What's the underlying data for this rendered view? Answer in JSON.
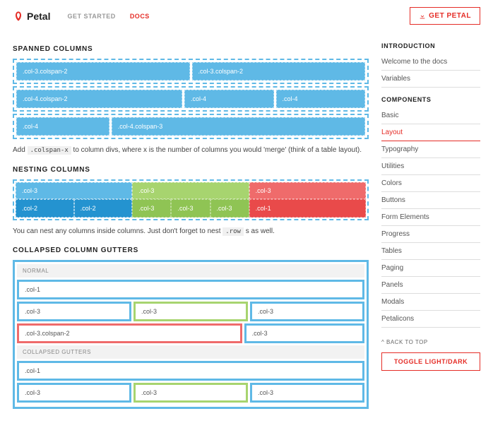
{
  "brand": "Petal",
  "nav": {
    "get_started": "GET STARTED",
    "docs": "DOCS"
  },
  "cta": "GET PETAL",
  "sidebar": {
    "intro_head": "INTRODUCTION",
    "intro": [
      "Welcome to the docs",
      "Variables"
    ],
    "comp_head": "COMPONENTS",
    "components": [
      "Basic",
      "Layout",
      "Typography",
      "Utilities",
      "Colors",
      "Buttons",
      "Form Elements",
      "Progress",
      "Tables",
      "Paging",
      "Panels",
      "Modals",
      "Petalicons"
    ],
    "active_index": 1,
    "back": "BACK TO TOP",
    "toggle": "TOGGLE LIGHT/DARK"
  },
  "sections": {
    "spanned": {
      "title": "SPANNED COLUMNS",
      "rows": [
        [
          {
            "label": ".col-3.colspan-2",
            "flex": 2
          },
          {
            "label": ".col-3.colspan-2",
            "flex": 2
          }
        ],
        [
          {
            "label": ".col-4.colspan-2",
            "flex": 2
          },
          {
            "label": ".col-4",
            "flex": 1
          },
          {
            "label": ".col-4",
            "flex": 1
          }
        ],
        [
          {
            "label": ".col-4",
            "flex": 1
          },
          {
            "label": ".col-4.colspan-3",
            "flex": 3
          }
        ]
      ],
      "desc_pre": "Add ",
      "desc_code": ".colspan-x",
      "desc_post": " to column divs, where x is the number of columns you would 'merge' (think of a table layout)."
    },
    "nesting": {
      "title": "NESTING COLUMNS",
      "cols": [
        {
          "head": ".col-3",
          "cells": [
            ".col-2",
            ".col-2"
          ],
          "outer": "blue-l",
          "inner": "blue-d"
        },
        {
          "head": ".col-3",
          "cells": [
            ".col-3",
            ".col-3",
            ".col-3"
          ],
          "outer": "green-l",
          "inner": "green-d"
        },
        {
          "head": ".col-3",
          "cells": [
            ".col-1"
          ],
          "outer": "red-l",
          "inner": "red-d"
        }
      ],
      "desc_pre": "You can nest any columns inside columns. Just don't forget to nest ",
      "desc_code": ".row",
      "desc_post": " s as well."
    },
    "collapsed": {
      "title": "COLLAPSED COLUMN GUTTERS",
      "normal_label": "NORMAL",
      "collapsed_label": "COLLAPSED GUTTERS",
      "rows_normal": [
        [
          {
            "label": ".col-1",
            "cls": ""
          }
        ],
        [
          {
            "label": ".col-3",
            "cls": ""
          },
          {
            "label": ".col-3",
            "cls": "green"
          },
          {
            "label": ".col-3",
            "cls": ""
          }
        ],
        [
          {
            "label": ".col-3.colspan-2",
            "cls": "red span2"
          },
          {
            "label": ".col-3",
            "cls": ""
          }
        ]
      ],
      "rows_collapsed": [
        [
          {
            "label": ".col-1",
            "cls": ""
          }
        ],
        [
          {
            "label": ".col-3",
            "cls": ""
          },
          {
            "label": ".col-3",
            "cls": "green"
          },
          {
            "label": ".col-3",
            "cls": ""
          }
        ]
      ]
    }
  }
}
